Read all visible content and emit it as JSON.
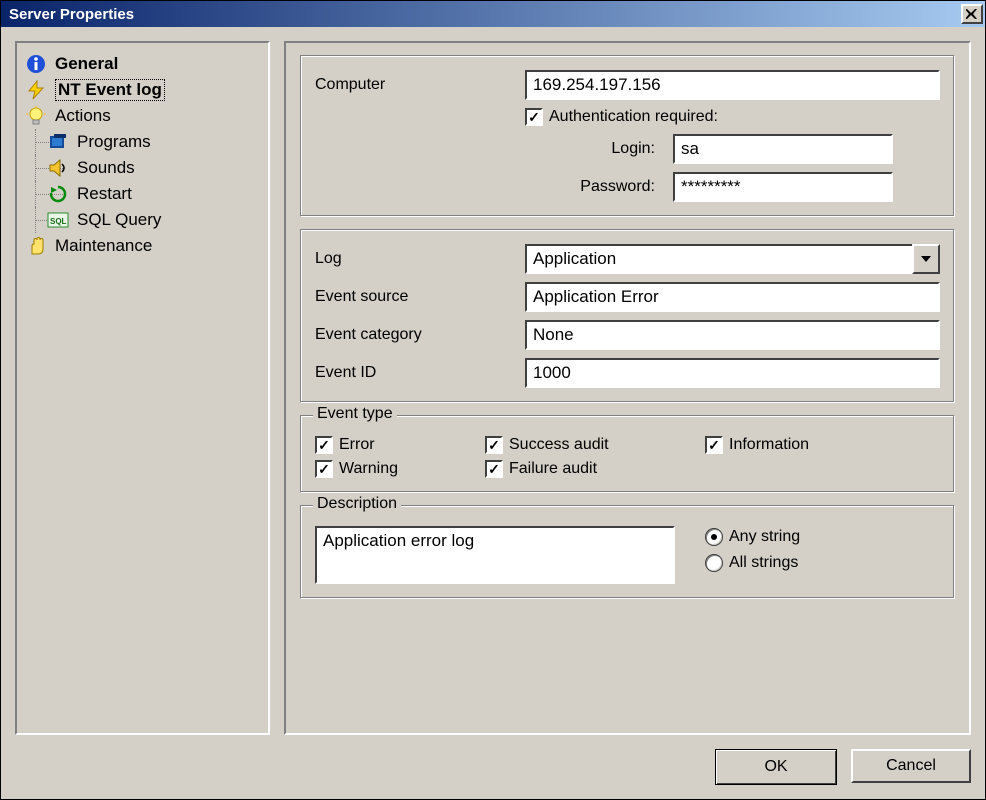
{
  "window": {
    "title": "Server Properties"
  },
  "nav": {
    "general": "General",
    "ntlog": "NT Event log",
    "actions": "Actions",
    "programs": "Programs",
    "sounds": "Sounds",
    "restart": "Restart",
    "sqlquery": "SQL Query",
    "maintenance": "Maintenance"
  },
  "conn": {
    "computer_label": "Computer",
    "computer_value": "169.254.197.156",
    "auth_label": "Authentication required:",
    "auth_checked": "✓",
    "login_label": "Login:",
    "login_value": "sa",
    "password_label": "Password:",
    "password_value": "*********"
  },
  "log": {
    "log_label": "Log",
    "log_value": "Application",
    "source_label": "Event source",
    "source_value": "Application Error",
    "category_label": "Event category",
    "category_value": "None",
    "id_label": "Event ID",
    "id_value": "1000"
  },
  "evtype": {
    "legend": "Event type",
    "error": "Error",
    "warning": "Warning",
    "success": "Success audit",
    "failure": "Failure audit",
    "information": "Information",
    "check": "✓"
  },
  "desc": {
    "legend": "Description",
    "text": "Application error log",
    "any": "Any string",
    "all": "All strings"
  },
  "buttons": {
    "ok": "OK",
    "cancel": "Cancel"
  }
}
